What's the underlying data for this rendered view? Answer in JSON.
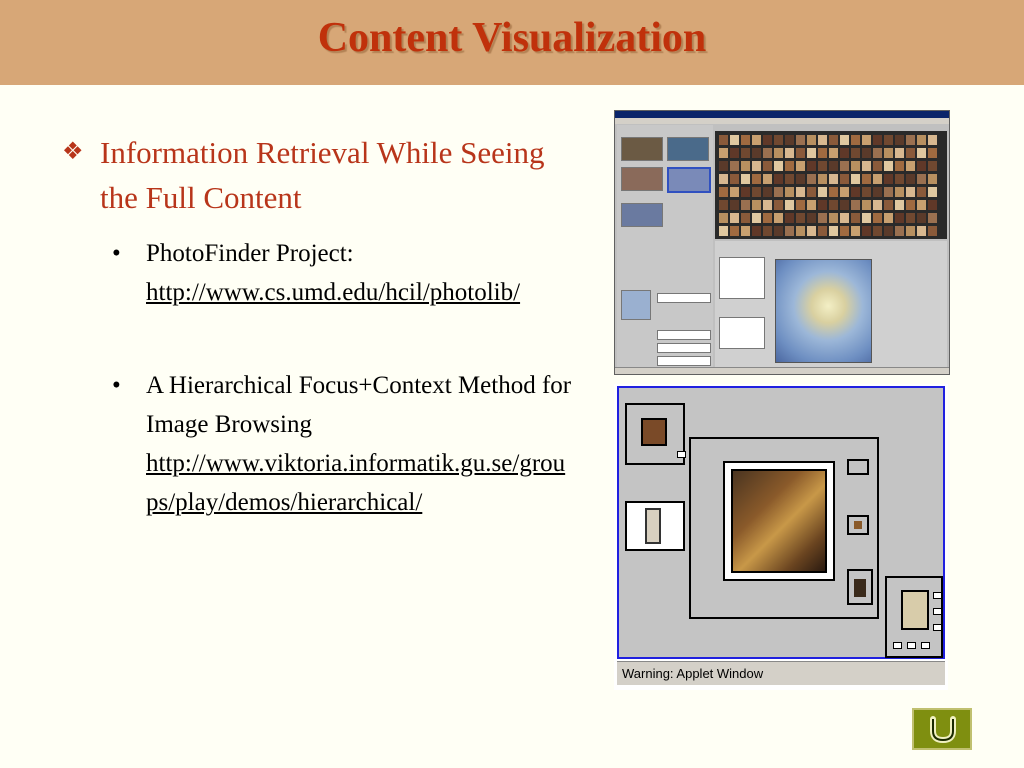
{
  "slide": {
    "title": "Content Visualization",
    "main_bullet": "Information Retrieval While Seeing the Full Content",
    "subbullets": [
      {
        "text": "PhotoFinder Project:",
        "link": "http://www.cs.umd.edu/hcil/photolib/"
      },
      {
        "text": "A Hierarchical Focus+Context Method for Image Browsing",
        "link": "http://www.viktoria.informatik.gu.se/groups/play/demos/hierarchical/"
      }
    ]
  },
  "applet": {
    "warning": "Warning: Applet Window"
  },
  "colors": {
    "title_bar": "#d7a777",
    "title_text": "#c0310b",
    "main_bullet": "#b8351a",
    "home_button": "#7f8f10"
  },
  "icons": {
    "bullet": "diamond-bullet-icon",
    "home": "return-u-arrow-icon"
  }
}
